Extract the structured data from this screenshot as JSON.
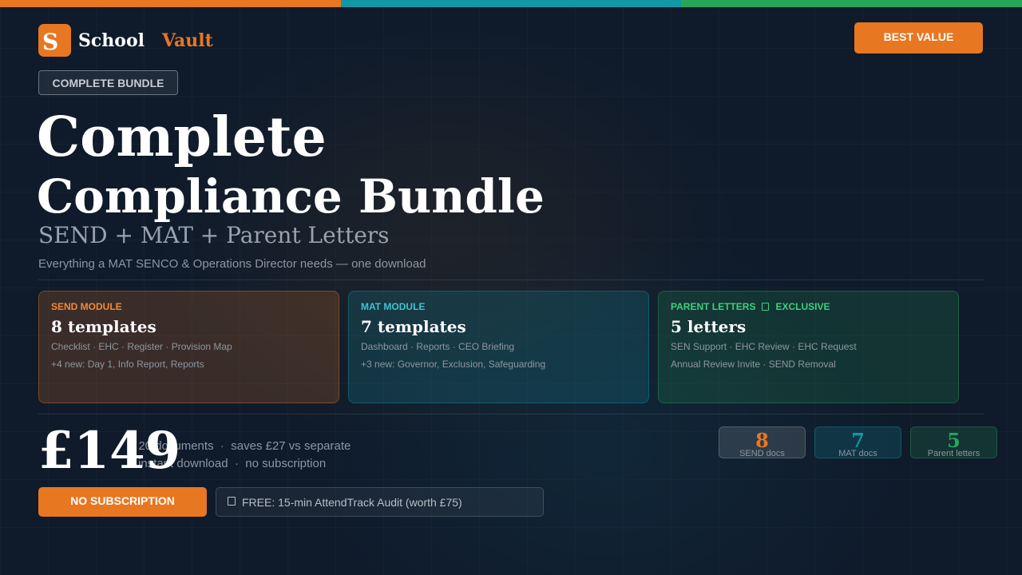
{
  "brand": {
    "mark": "S",
    "name_a": "School",
    "name_b": "Vault"
  },
  "header": {
    "best_value_label": "BEST VALUE",
    "badge": "COMPLETE BUNDLE"
  },
  "hero": {
    "title_line_1": "Complete",
    "title_line_2": "Compliance Bundle",
    "subtitle": "SEND + MAT + Parent Letters",
    "tagline": "Everything a MAT SENCO & Operations Director needs — one download"
  },
  "modules": [
    {
      "label": "SEND MODULE",
      "count": "8 templates",
      "line_1": "Checklist · EHC · Register · Provision Map",
      "line_2": "+4 new: Day 1, Info Report, Reports"
    },
    {
      "label": "MAT MODULE",
      "count": "7 templates",
      "line_1": "Dashboard · Reports · CEO Briefing",
      "line_2": "+3 new: Governor, Exclusion, Safeguarding"
    },
    {
      "label_a": "PARENT LETTERS",
      "label_b": "EXCLUSIVE",
      "count": "5 letters",
      "line_1": "SEN Support · EHC Review · EHC Request",
      "line_2": "Annual Review Invite · SEND Removal"
    }
  ],
  "pricing": {
    "price": "£149",
    "meta_a": "20 documents",
    "meta_b": "saves £27 vs separate",
    "meta_c": "instant download",
    "meta_d": "no subscription",
    "separator": "·"
  },
  "stats": [
    {
      "value": "8",
      "label": "SEND docs"
    },
    {
      "value": "7",
      "label": "MAT docs"
    },
    {
      "value": "5",
      "label": "Parent letters"
    }
  ],
  "cta": {
    "no_subscription_label": "NO SUBSCRIPTION",
    "audit_label": "FREE: 15-min AttendTrack Audit (worth £75)"
  },
  "colors": {
    "accent": "#e87722",
    "teal": "#1397a4",
    "green": "#27a659",
    "background": "#0f1b2b"
  },
  "icons": {
    "audit": "gift-icon",
    "exclusive": "star-icon"
  }
}
